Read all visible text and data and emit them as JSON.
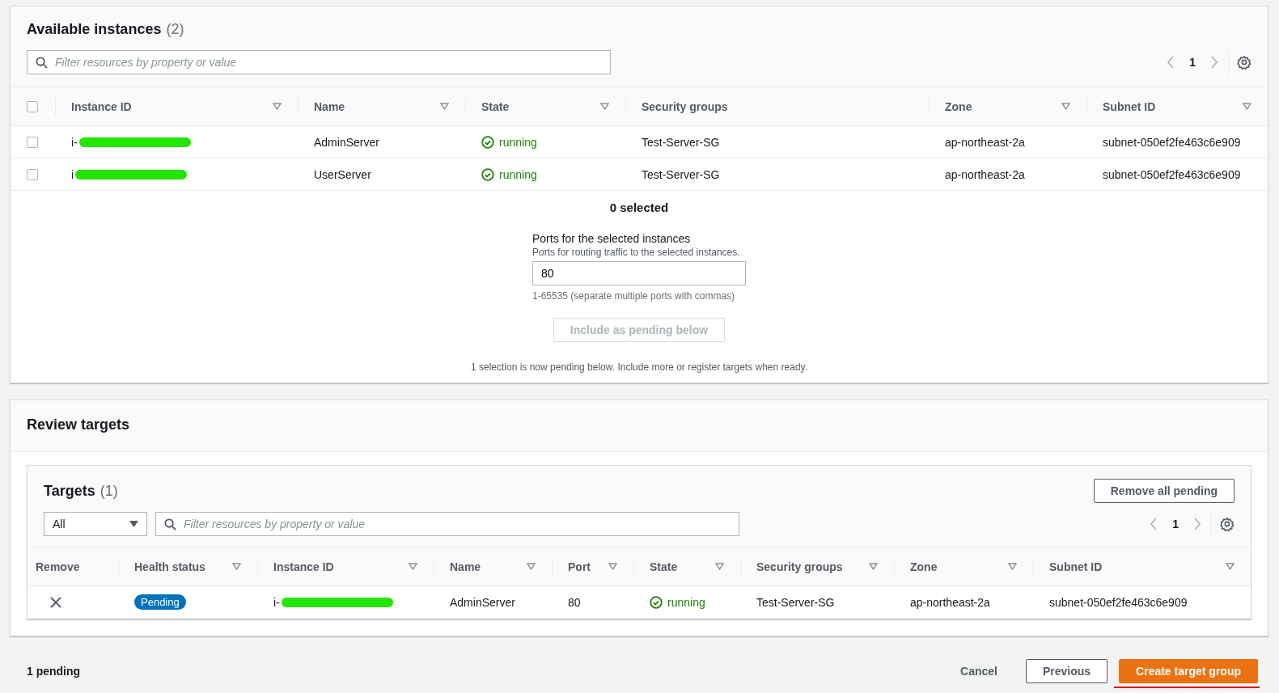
{
  "available": {
    "title": "Available instances",
    "count": "(2)",
    "search": {
      "placeholder": "Filter resources by property or value"
    },
    "page": "1",
    "columns": [
      {
        "kind": "check",
        "checked": false
      },
      {
        "kind": "id",
        "label": "Instance ID",
        "sortable": true
      },
      {
        "kind": "text",
        "label": "Name",
        "sortable": true
      },
      {
        "kind": "state",
        "label": "State",
        "sortable": true
      },
      {
        "kind": "text",
        "label": "Security groups",
        "sortable": false
      },
      {
        "kind": "text",
        "label": "Zone",
        "sortable": true
      },
      {
        "kind": "text",
        "label": "Subnet ID",
        "sortable": true
      }
    ],
    "rows": [
      {
        "checked": false,
        "cells": [
          "",
          "i-",
          "AdminServer",
          "running",
          "Test-Server-SG",
          "ap-northeast-2a",
          "subnet-050ef2fe463c6e909"
        ]
      },
      {
        "checked": false,
        "cells": [
          "",
          "i",
          "UserServer",
          "running",
          "Test-Server-SG",
          "ap-northeast-2a",
          "subnet-050ef2fe463c6e909"
        ]
      }
    ],
    "selected_count": "0 selected",
    "ports_label": "Ports for the selected instances",
    "ports_description": "Ports for routing traffic to the selected instances.",
    "ports_value": "80",
    "ports_hint": "1-65535 (separate multiple ports with commas)",
    "include_button": {
      "label": "Include as pending below",
      "disabled": true
    },
    "pending_note": "1 selection is now pending below. Include more or register targets when ready."
  },
  "review": {
    "title": "Review targets",
    "targets_title": "Targets",
    "targets_count": "(1)",
    "remove_all_button": "Remove all pending",
    "filter_select": "All",
    "search": {
      "placeholder": "Filter resources by property or value"
    },
    "page": "1",
    "columns": [
      {
        "kind": "remove",
        "label": "Remove",
        "sortable": false
      },
      {
        "kind": "badge",
        "label": "Health status",
        "sortable": true
      },
      {
        "kind": "id",
        "label": "Instance ID",
        "sortable": true
      },
      {
        "kind": "text",
        "label": "Name",
        "sortable": true
      },
      {
        "kind": "text",
        "label": "Port",
        "sortable": true
      },
      {
        "kind": "state",
        "label": "State",
        "sortable": true
      },
      {
        "kind": "text",
        "label": "Security groups",
        "sortable": true
      },
      {
        "kind": "text",
        "label": "Zone",
        "sortable": true
      },
      {
        "kind": "text",
        "label": "Subnet ID",
        "sortable": true
      }
    ],
    "rows": [
      {
        "cells": [
          "",
          "Pending",
          "i-",
          "AdminServer",
          "80",
          "running",
          "Test-Server-SG",
          "ap-northeast-2a",
          "subnet-050ef2fe463c6e909"
        ]
      }
    ]
  },
  "footer": {
    "pending": "1 pending",
    "cancel": "Cancel",
    "previous": "Previous",
    "create": "Create target group"
  }
}
